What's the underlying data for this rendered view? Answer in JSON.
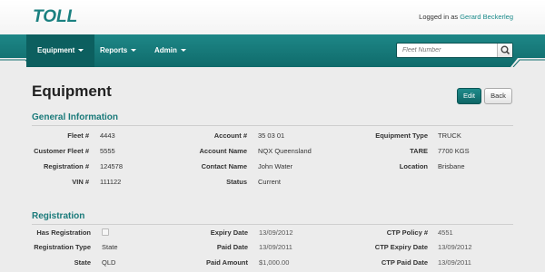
{
  "brand": {
    "name": "TOLL"
  },
  "header": {
    "logged_in_prefix": "Logged in as",
    "user_name": "Gerard Beckerleg"
  },
  "nav": {
    "items": [
      {
        "label": "Equipment"
      },
      {
        "label": "Reports"
      },
      {
        "label": "Admin"
      }
    ],
    "search_placeholder": "Fleet Number"
  },
  "page": {
    "title": "Equipment",
    "edit_label": "Edit",
    "back_label": "Back"
  },
  "general": {
    "title": "General Information",
    "col1": [
      {
        "label": "Fleet #",
        "value": "4443"
      },
      {
        "label": "Customer Fleet #",
        "value": "5555"
      },
      {
        "label": "Registration #",
        "value": "124578"
      },
      {
        "label": "VIN #",
        "value": "111122"
      }
    ],
    "col2": [
      {
        "label": "Account #",
        "value": "35 03 01"
      },
      {
        "label": "Account Name",
        "value": "NQX Queensland"
      },
      {
        "label": "Contact Name",
        "value": "John Water"
      },
      {
        "label": "Status",
        "value": "Current"
      }
    ],
    "col3": [
      {
        "label": "Equipment Type",
        "value": "TRUCK"
      },
      {
        "label": "TARE",
        "value": "7700 KGS"
      },
      {
        "label": "Location",
        "value": "Brisbane"
      }
    ]
  },
  "registration": {
    "title": "Registration",
    "col1": [
      {
        "label": "Has Registration",
        "checked": false
      },
      {
        "label": "Registration Type",
        "value": "State"
      },
      {
        "label": "State",
        "value": "QLD"
      }
    ],
    "col2": [
      {
        "label": "Expiry Date",
        "value": "13/09/2012"
      },
      {
        "label": "Paid Date",
        "value": "13/09/2011"
      },
      {
        "label": "Paid Amount",
        "value": "$1,000.00"
      }
    ],
    "col3": [
      {
        "label": "CTP Policy #",
        "value": "4551"
      },
      {
        "label": "CTP Expiry Date",
        "value": "13/09/2012"
      },
      {
        "label": "CTP Paid Date",
        "value": "13/09/2011"
      }
    ]
  },
  "colors": {
    "brand_teal": "#1a8080",
    "nav_dark": "#0f6b6b",
    "section_title": "#1a7a7a"
  }
}
